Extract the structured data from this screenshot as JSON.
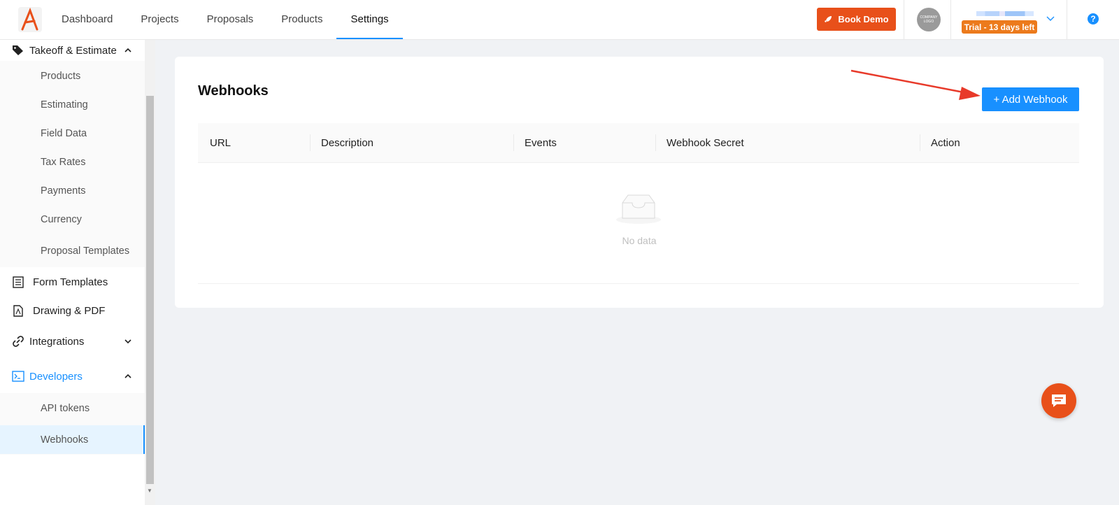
{
  "nav": {
    "items": [
      {
        "label": "Dashboard",
        "active": false
      },
      {
        "label": "Projects",
        "active": false
      },
      {
        "label": "Proposals",
        "active": false
      },
      {
        "label": "Products",
        "active": false
      },
      {
        "label": "Settings",
        "active": true
      }
    ]
  },
  "header": {
    "book_demo_label": "Book Demo",
    "company_logo_line1": "COMPANY",
    "company_logo_line2": "LOGO",
    "trial_badge": "Trial - 13 days left",
    "brand_color": "#e8501a",
    "accent_color": "#1890ff"
  },
  "sidebar": {
    "takeoff_label": "Takeoff & Estimate",
    "takeoff_sub": [
      "Products",
      "Estimating",
      "Field Data",
      "Tax Rates",
      "Payments",
      "Currency",
      "Proposal Templates"
    ],
    "form_templates_label": "Form Templates",
    "drawing_pdf_label": "Drawing & PDF",
    "integrations_label": "Integrations",
    "developers_label": "Developers",
    "developers_sub": [
      "API tokens",
      "Webhooks"
    ],
    "selected": "Webhooks"
  },
  "main": {
    "title": "Webhooks",
    "add_button": "+ Add Webhook",
    "columns": [
      "URL",
      "Description",
      "Events",
      "Webhook Secret",
      "Action"
    ],
    "empty_text": "No data"
  }
}
